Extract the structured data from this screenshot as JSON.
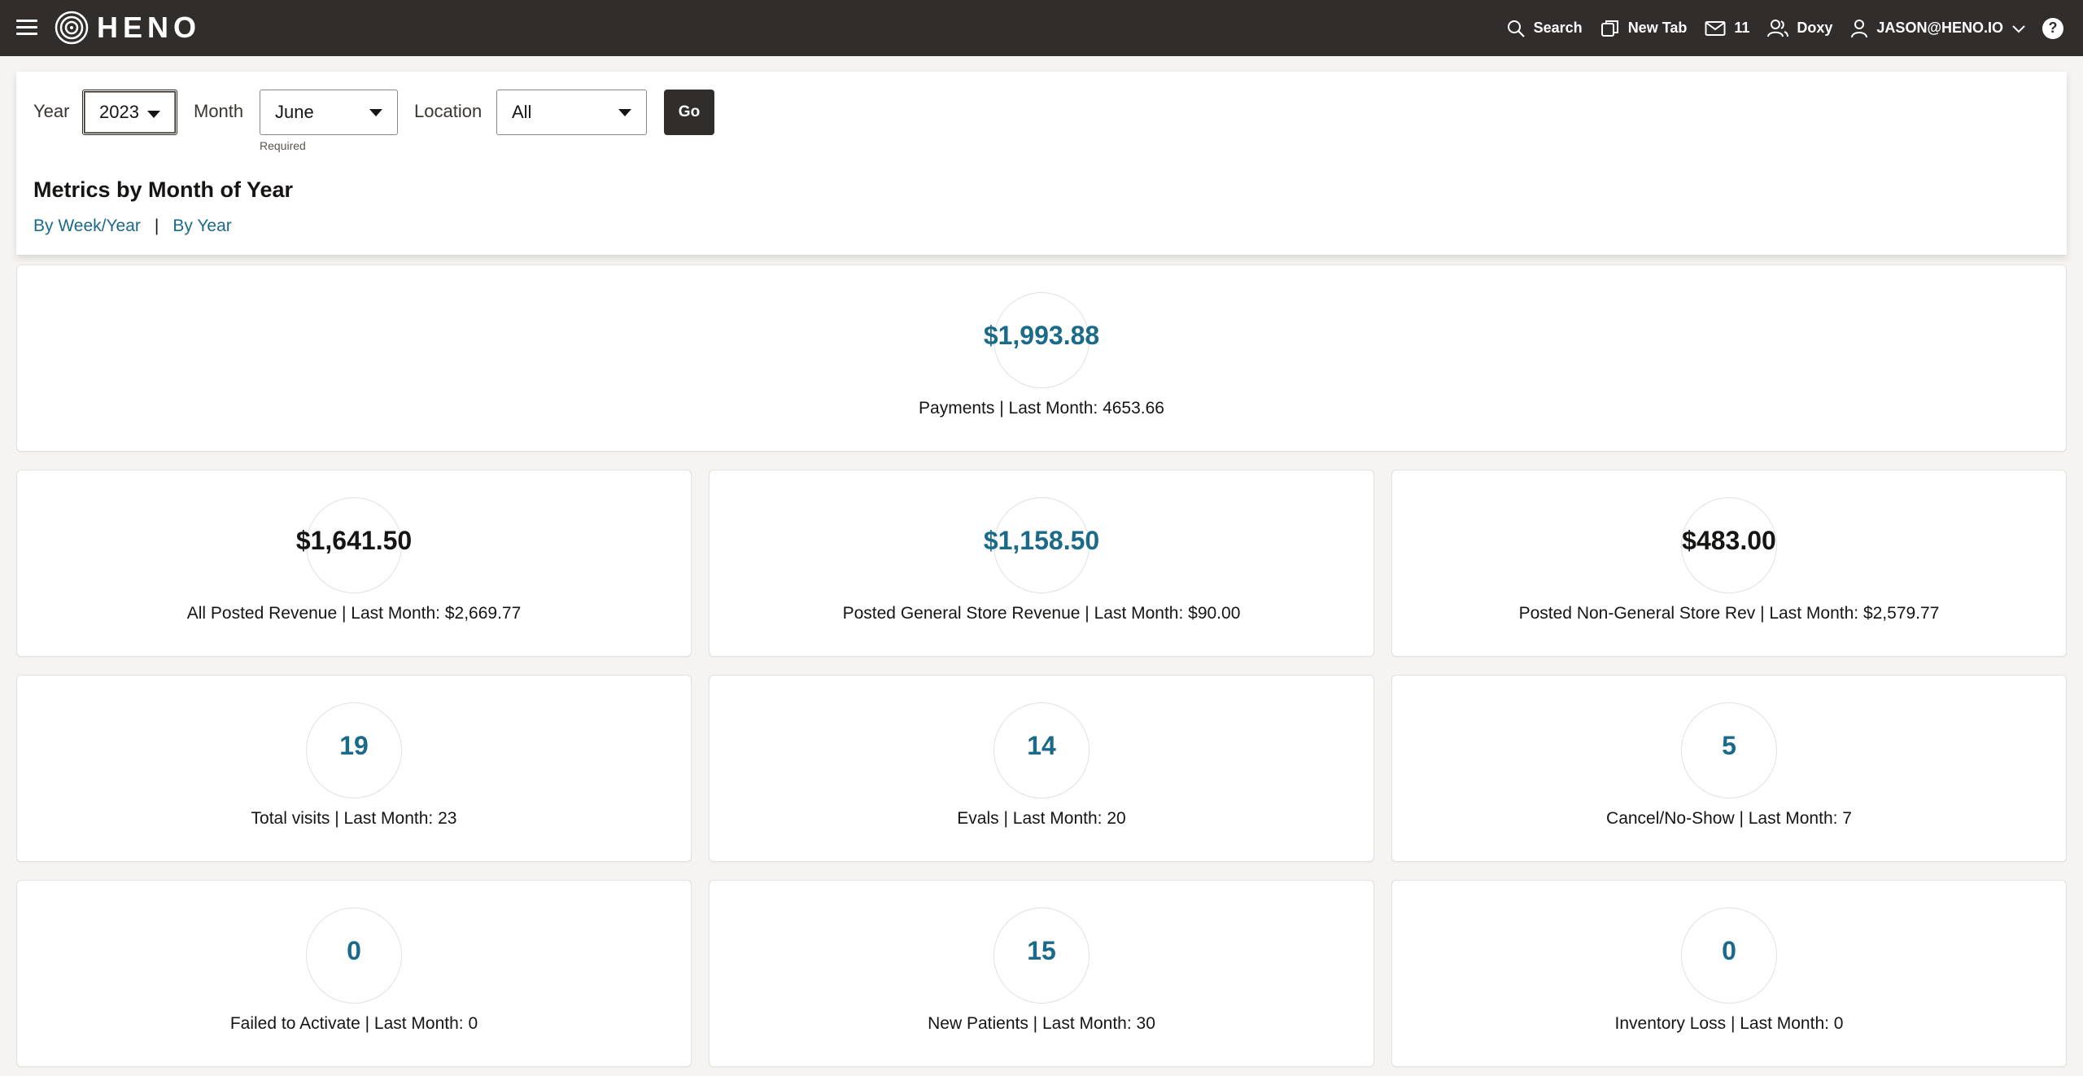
{
  "brand": {
    "name": "HENO"
  },
  "topnav": {
    "search_label": "Search",
    "new_tab_label": "New Tab",
    "mail_count": "11",
    "doxy_label": "Doxy",
    "user_label": "JASON@HENO.IO",
    "help_label": "?"
  },
  "filters": {
    "year_label": "Year",
    "year_value": "2023",
    "month_label": "Month",
    "month_value": "June",
    "month_hint": "Required",
    "location_label": "Location",
    "location_value": "All",
    "go_label": "Go"
  },
  "section": {
    "title": "Metrics by Month of Year",
    "link_week": "By Week/Year",
    "separator": "|",
    "link_year": "By Year"
  },
  "metrics": [
    {
      "value": "$1,993.88",
      "label": "Payments | Last Month: 4653.66",
      "color": "blue"
    },
    {
      "value": "$1,641.50",
      "label": "All Posted Revenue | Last Month: $2,669.77",
      "color": "dark"
    },
    {
      "value": "$1,158.50",
      "label": "Posted General Store Revenue | Last Month: $90.00",
      "color": "blue"
    },
    {
      "value": "$483.00",
      "label": "Posted Non-General Store Rev | Last Month: $2,579.77",
      "color": "dark"
    },
    {
      "value": "19",
      "label": "Total visits | Last Month: 23",
      "color": "blue"
    },
    {
      "value": "14",
      "label": "Evals | Last Month: 20",
      "color": "blue"
    },
    {
      "value": "5",
      "label": "Cancel/No-Show | Last Month: 7",
      "color": "blue"
    },
    {
      "value": "0",
      "label": "Failed to Activate | Last Month: 0",
      "color": "blue"
    },
    {
      "value": "15",
      "label": "New Patients | Last Month: 30",
      "color": "blue"
    },
    {
      "value": "0",
      "label": "Inventory Loss | Last Month: 0",
      "color": "blue"
    }
  ],
  "colors": {
    "topbar": "#312d2a",
    "link": "#1a6a8a",
    "value_blue": "#1a6a8a",
    "value_dark": "#161513"
  }
}
